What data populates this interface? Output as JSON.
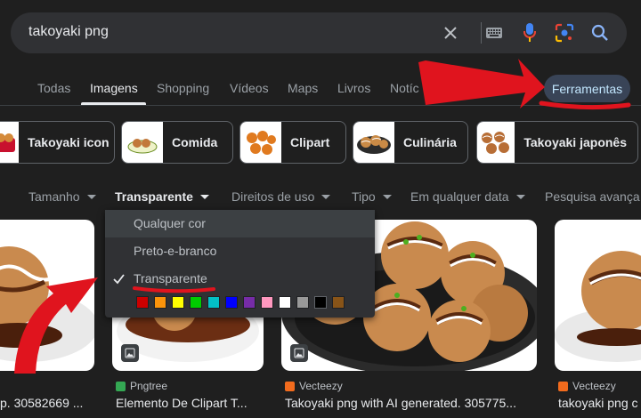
{
  "search": {
    "query": "takoyaki png",
    "icons": [
      "close-icon",
      "keyboard-icon",
      "microphone-icon",
      "lens-icon",
      "search-icon"
    ]
  },
  "nav": {
    "tabs": [
      "Todas",
      "Imagens",
      "Shopping",
      "Vídeos",
      "Maps",
      "Livros",
      "Notíc"
    ],
    "active_tab": "Imagens",
    "tools_label": "Ferramentas"
  },
  "chips": [
    {
      "label": "Takoyaki icon"
    },
    {
      "label": "Comida"
    },
    {
      "label": "Clipart"
    },
    {
      "label": "Culinária"
    },
    {
      "label": "Takoyaki japonês"
    }
  ],
  "filters": {
    "items": [
      "Tamanho",
      "Transparente",
      "Direitos de uso",
      "Tipo",
      "Em qualquer data",
      "Pesquisa avança"
    ],
    "active": "Transparente"
  },
  "color_menu": {
    "items": [
      "Qualquer cor",
      "Preto-e-branco",
      "Transparente"
    ],
    "selected": "Transparente",
    "swatches": [
      "#cc0000",
      "#fb940b",
      "#ffff00",
      "#00cc00",
      "#03c0c6",
      "#0000ff",
      "#762ca7",
      "#ff98bf",
      "#ffffff",
      "#999999",
      "#000000",
      "#885418"
    ]
  },
  "results": [
    {
      "source": "",
      "title": "p. 30582669 ..."
    },
    {
      "source": "Pngtree",
      "title": "Elemento De Clipart T..."
    },
    {
      "source": "Vecteezy",
      "title": "Takoyaki png with AI generated. 305775..."
    },
    {
      "source": "Vecteezy",
      "title": "takoyaki png c"
    }
  ],
  "colors": {
    "accent": "#c2e7ff",
    "tools_bg": "#394457",
    "annotation_red": "#e0141e"
  }
}
